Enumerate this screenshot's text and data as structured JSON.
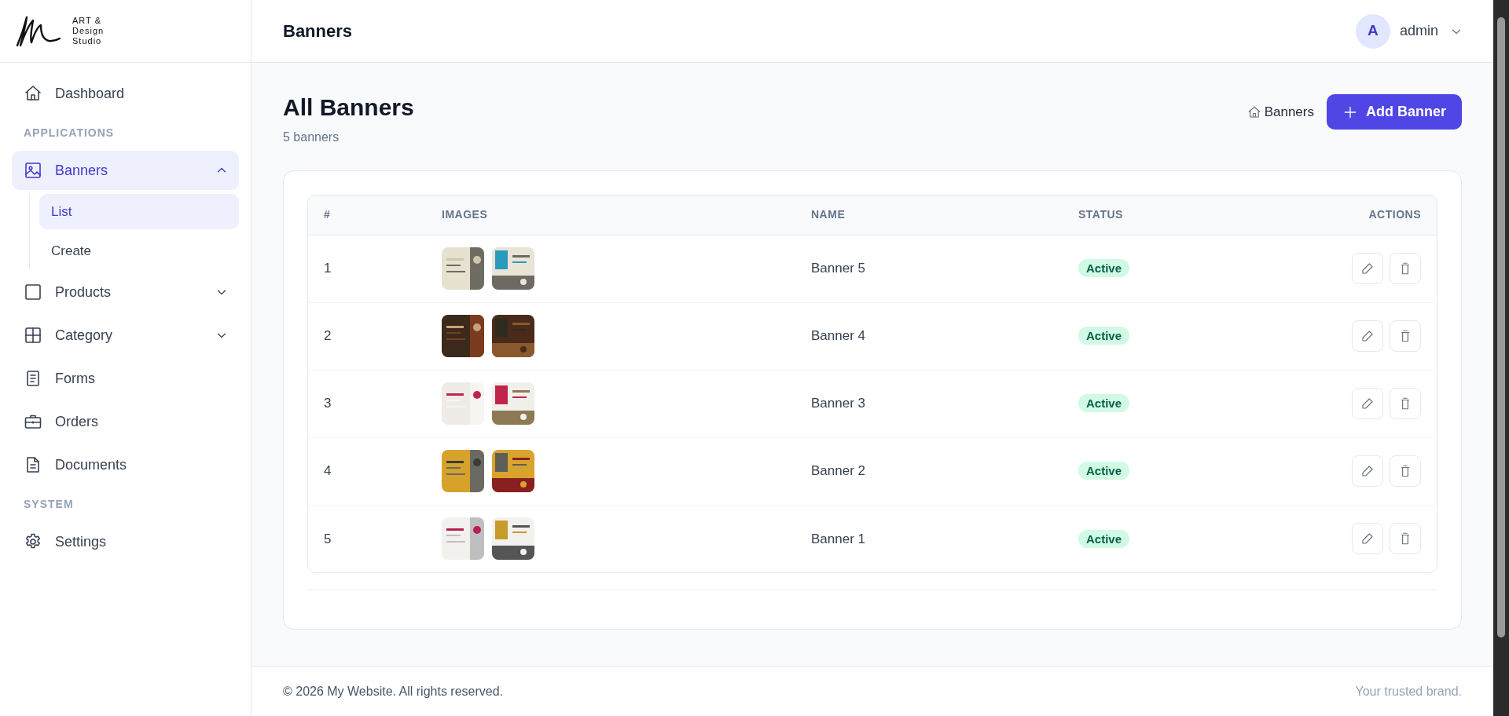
{
  "brand": {
    "lines": [
      "ART &",
      "Design",
      "Studio"
    ]
  },
  "sidebar": {
    "items": [
      {
        "kind": "link",
        "label": "Dashboard",
        "selected": false
      },
      {
        "kind": "section",
        "label": "APPLICATIONS"
      },
      {
        "kind": "group",
        "label": "Banners",
        "selected": true,
        "expanded": true,
        "children": [
          {
            "label": "List",
            "selected": true
          },
          {
            "label": "Create",
            "selected": false
          }
        ]
      },
      {
        "kind": "group",
        "label": "Products",
        "selected": false,
        "expanded": false
      },
      {
        "kind": "group",
        "label": "Category",
        "selected": false,
        "expanded": false
      },
      {
        "kind": "link",
        "label": "Forms",
        "selected": false
      },
      {
        "kind": "link",
        "label": "Orders",
        "selected": false
      },
      {
        "kind": "link",
        "label": "Documents",
        "selected": false
      },
      {
        "kind": "section",
        "label": "SYSTEM"
      },
      {
        "kind": "link",
        "label": "Settings",
        "selected": false
      }
    ]
  },
  "header": {
    "title": "Banners",
    "user": {
      "initial": "A",
      "name": "admin"
    }
  },
  "page": {
    "title": "All Banners",
    "subtitle": "5 banners",
    "breadcrumb": "Banners",
    "add_button": "Add Banner"
  },
  "table": {
    "columns": [
      "#",
      "IMAGES",
      "NAME",
      "STATUS",
      "ACTIONS"
    ],
    "rows": [
      {
        "index": "1",
        "name": "Banner 5",
        "status": "Active"
      },
      {
        "index": "2",
        "name": "Banner 4",
        "status": "Active"
      },
      {
        "index": "3",
        "name": "Banner 3",
        "status": "Active"
      },
      {
        "index": "4",
        "name": "Banner 2",
        "status": "Active"
      },
      {
        "index": "5",
        "name": "Banner 1",
        "status": "Active"
      }
    ]
  },
  "footer": {
    "copyright": "© 2026 My Website. All rights reserved.",
    "tagline": "Your trusted brand."
  }
}
